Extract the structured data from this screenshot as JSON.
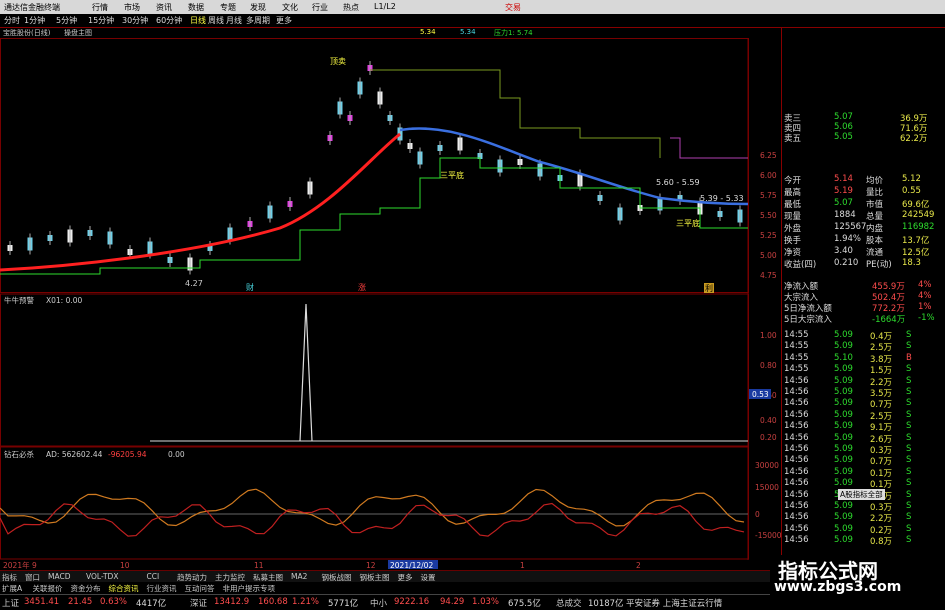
{
  "titlebar": {
    "app": "通达信金融终端",
    "menu": [
      "行情",
      "市场",
      "资讯",
      "数据",
      "专题",
      "发现",
      "文化",
      "行业",
      "热点",
      "L1/L2"
    ],
    "right": "交易"
  },
  "toolbar": {
    "periods": [
      "分时",
      "1分钟",
      "5分钟",
      "15分钟",
      "30分钟",
      "60分钟",
      "日线",
      "周线",
      "月线",
      "多周期",
      "更多"
    ]
  },
  "main_header": {
    "stock": "宝胜股份(日线)",
    "indicator": "操盘主图",
    "value1": "5.34",
    "value2": "5.34",
    "pressure": "压力1: 5.74"
  },
  "chart_labels": {
    "top_price": "6.00",
    "price_prices": [
      "6.25",
      "6.00",
      "5.75",
      "5.50",
      "5.25",
      "5.00",
      "4.75"
    ],
    "low_label": "4.27",
    "sanping_label": "三平底",
    "range_label": "5.60 - 5.59",
    "range2": "5.39 - 5.33",
    "ding": "顶卖",
    "markers": [
      "财",
      "涨",
      "利"
    ]
  },
  "subchart1": {
    "name": "牛牛预警",
    "text": "X01: 0.00",
    "ticks": [
      "1.00",
      "0.80",
      "0.60",
      "0.40",
      "0.20"
    ],
    "tag": "0.53"
  },
  "subchart2": {
    "name": "钻石必杀",
    "a": "AD: 562602.44",
    "b": "-96205.94",
    "c": "0.00",
    "ticks": [
      "30000",
      "15000",
      "0",
      "-15000"
    ]
  },
  "xaxis": {
    "labels": [
      "2021年 9",
      "10",
      "11",
      "12",
      "2021/12/02",
      "1",
      "2"
    ]
  },
  "quote": {
    "sell": [
      {
        "l": "卖三",
        "p": "5.07",
        "v": "36.9万"
      },
      {
        "l": "卖四",
        "p": "5.06",
        "v": "71.6万"
      },
      {
        "l": "卖五",
        "p": "5.05",
        "v": "62.2万"
      }
    ],
    "rows": [
      {
        "l": "今开",
        "v": "5.14",
        "l2": "均价",
        "v2": "5.12"
      },
      {
        "l": "最高",
        "v": "5.19",
        "l2": "量比",
        "v2": "0.55"
      },
      {
        "l": "最低",
        "v": "5.07",
        "l2": "市值",
        "v2": "69.6亿"
      },
      {
        "l": "现量",
        "v": "1884",
        "l2": "总量",
        "v2": "242549"
      },
      {
        "l": "外盘",
        "v": "125567",
        "l2": "内盘",
        "v2": "116982"
      },
      {
        "l": "换手",
        "v": "1.94%",
        "l2": "股本",
        "v2": "13.7亿"
      },
      {
        "l": "净资",
        "v": "3.40",
        "l2": "流通",
        "v2": "12.5亿"
      },
      {
        "l": "收益(四)",
        "v": "0.210",
        "l2": "PE(动)",
        "v2": "18.3"
      }
    ],
    "flow": [
      {
        "l": "净流入额",
        "v": "455.9万",
        "p": "4%"
      },
      {
        "l": "大宗流入",
        "v": "502.4万",
        "p": "4%"
      },
      {
        "l": "5日净流入额",
        "v": "772.2万",
        "p": "1%"
      },
      {
        "l": "5日大宗流入",
        "v": "-1664万",
        "p": "-1%"
      }
    ],
    "ticks": [
      {
        "t": "14:55",
        "p": "5.09",
        "v": "0.4万",
        "d": "S"
      },
      {
        "t": "14:55",
        "p": "5.09",
        "v": "2.5万",
        "d": "S"
      },
      {
        "t": "14:55",
        "p": "5.10",
        "v": "3.8万",
        "d": "B"
      },
      {
        "t": "14:55",
        "p": "5.09",
        "v": "1.5万",
        "d": "S"
      },
      {
        "t": "14:56",
        "p": "5.09",
        "v": "2.2万",
        "d": "S"
      },
      {
        "t": "14:56",
        "p": "5.09",
        "v": "3.5万",
        "d": "S"
      },
      {
        "t": "14:56",
        "p": "5.09",
        "v": "0.7万",
        "d": "S"
      },
      {
        "t": "14:56",
        "p": "5.09",
        "v": "2.5万",
        "d": "S"
      },
      {
        "t": "14:56",
        "p": "5.09",
        "v": "9.1万",
        "d": "S"
      },
      {
        "t": "14:56",
        "p": "5.09",
        "v": "2.6万",
        "d": "S"
      },
      {
        "t": "14:56",
        "p": "5.09",
        "v": "0.3万",
        "d": "S"
      },
      {
        "t": "14:56",
        "p": "5.09",
        "v": "0.7万",
        "d": "S"
      },
      {
        "t": "14:56",
        "p": "5.09",
        "v": "0.1万",
        "d": "S"
      },
      {
        "t": "14:56",
        "p": "5.09",
        "v": "0.1万",
        "d": "S"
      },
      {
        "t": "14:56",
        "p": "5.09",
        "v": "0.2万",
        "d": "S"
      },
      {
        "t": "14:56",
        "p": "5.09",
        "v": "0.3万",
        "d": "S"
      },
      {
        "t": "14:56",
        "p": "5.09",
        "v": "2.2万",
        "d": "S"
      },
      {
        "t": "14:56",
        "p": "5.09",
        "v": "0.2万",
        "d": "S"
      },
      {
        "t": "14:56",
        "p": "5.09",
        "v": "0.8万",
        "d": "S"
      }
    ],
    "select_label": "A股指标全部"
  },
  "bottom_tabs": [
    "指标",
    "窗口",
    "MACD",
    "VOL-TDX",
    "CCI",
    "趋势动力",
    "主力监控",
    "私募主图",
    "MA2",
    "钢板战图",
    "钢板主图",
    "更多",
    "设置"
  ],
  "bottom_tabs2": [
    "扩展A",
    "关联报价",
    "资金分布",
    "综合资讯",
    "行业资讯",
    "互动问答",
    "非用户提示专项"
  ],
  "status": {
    "sh_label": "上证",
    "sh": "3451.41",
    "sh_c": "21.45",
    "sh_p": "0.63%",
    "sh_v": "4417亿",
    "sz_label": "深证",
    "sz": "13412.9",
    "sz_c": "160.68",
    "sz_p": "1.21%",
    "sz_v": "5771亿",
    "zx_label": "中小",
    "zx": "9222.16",
    "zx_c": "94.29",
    "zx_p": "1.03%",
    "zx_v": "675.5亿",
    "total_label": "总成交",
    "total": "10187亿",
    "news": "平安证券 上海主证云行情"
  },
  "watermark": {
    "title": "指标公式网",
    "url": "www.zbgs3.com"
  },
  "colors": {
    "up": "#ff3b3b",
    "down": "#2edc2e",
    "ma": "#ff2020",
    "ma2": "#3a6fe0"
  }
}
